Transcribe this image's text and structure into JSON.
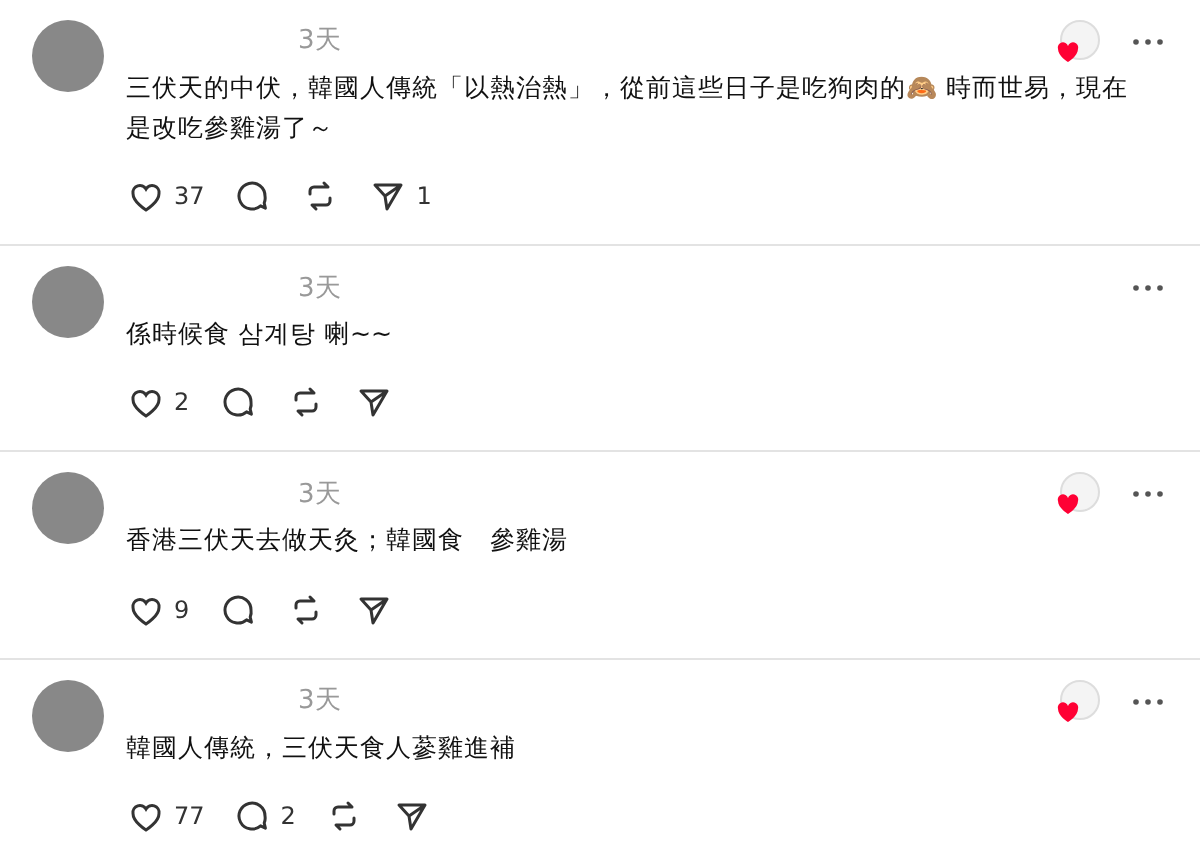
{
  "posts": [
    {
      "time": "3天",
      "text": "三伏天的中伏，韓國人傳統「以熱治熱」，從前這些日子是吃狗肉的🙈 時而世易，現在是改吃參雞湯了～",
      "author_liked": true,
      "likes": "37",
      "shares": "1"
    },
    {
      "time": "3天",
      "text": "係時候食 삼계탕 喇~~",
      "author_liked": false,
      "likes": "2"
    },
    {
      "time": "3天",
      "text": "香港三伏天去做天灸；韓國食　參雞湯",
      "author_liked": true,
      "likes": "9"
    },
    {
      "time": "3天",
      "text": "韓國人傳統，三伏天食人蔘雞進補",
      "author_liked": true,
      "likes": "77",
      "replies": "2"
    }
  ]
}
